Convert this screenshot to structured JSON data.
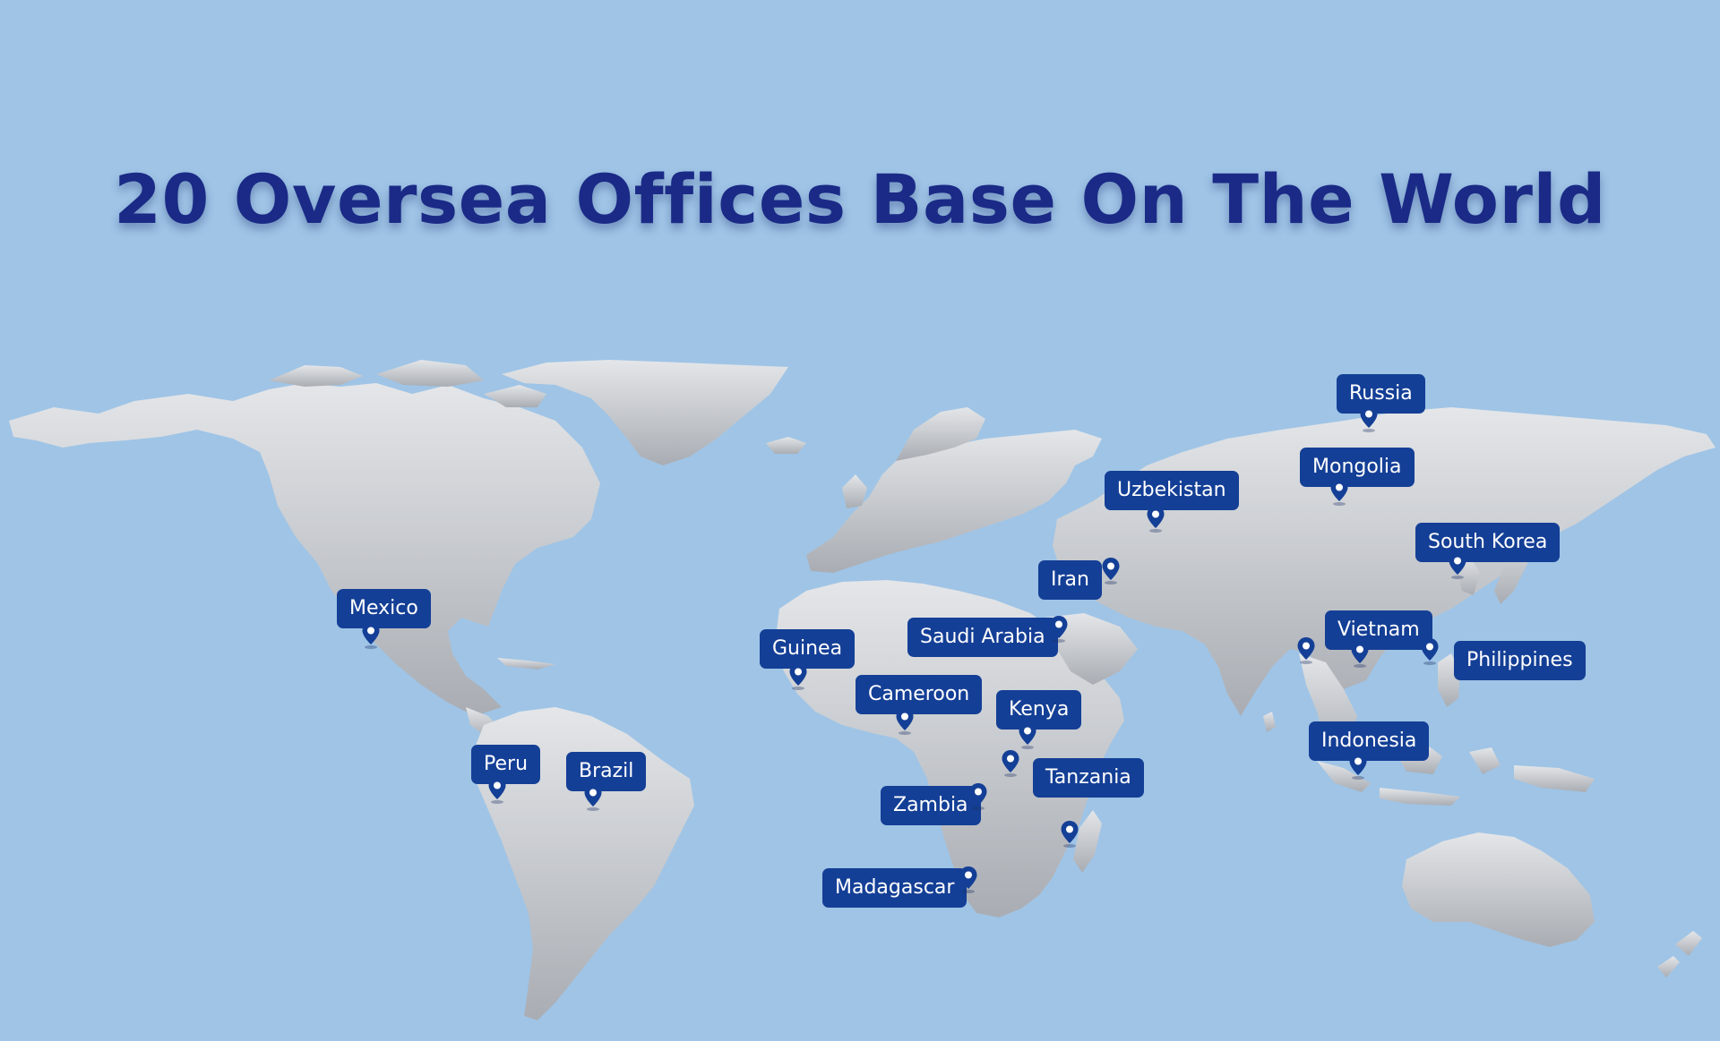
{
  "title": "20 Oversea Offices Base On The World",
  "colors": {
    "ocean": "#9fc4e6",
    "land": "#c3c7cc",
    "title": "#1a2a86",
    "label_bg": "#143f96",
    "label_text": "#ffffff",
    "pin": "#143f96"
  },
  "offices": [
    {
      "id": "russia",
      "name": "Russia"
    },
    {
      "id": "mongolia",
      "name": "Mongolia"
    },
    {
      "id": "uzbekistan",
      "name": "Uzbekistan"
    },
    {
      "id": "south-korea",
      "name": "South Korea"
    },
    {
      "id": "iran",
      "name": "Iran"
    },
    {
      "id": "mexico",
      "name": "Mexico"
    },
    {
      "id": "saudi-arabia",
      "name": "Saudi Arabia"
    },
    {
      "id": "guinea",
      "name": "Guinea"
    },
    {
      "id": "vietnam",
      "name": "Vietnam"
    },
    {
      "id": "philippines",
      "name": "Philippines"
    },
    {
      "id": "cameroon",
      "name": "Cameroon"
    },
    {
      "id": "kenya",
      "name": "Kenya"
    },
    {
      "id": "indonesia",
      "name": "Indonesia"
    },
    {
      "id": "peru",
      "name": "Peru"
    },
    {
      "id": "brazil",
      "name": "Brazil"
    },
    {
      "id": "tanzania",
      "name": "Tanzania"
    },
    {
      "id": "zambia",
      "name": "Zambia"
    },
    {
      "id": "madagascar",
      "name": "Madagascar"
    }
  ]
}
